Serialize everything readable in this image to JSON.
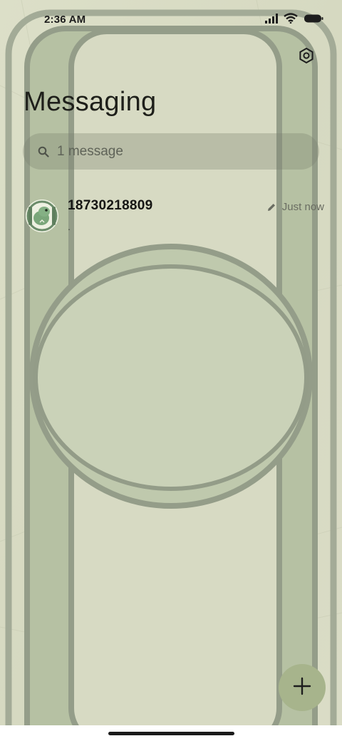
{
  "status_bar": {
    "time": "2:36 AM",
    "icons": [
      "signal-icon",
      "wifi-icon",
      "battery-icon"
    ]
  },
  "header": {
    "title": "Messaging",
    "settings_icon": "settings-icon"
  },
  "search": {
    "placeholder": "1 message",
    "icon": "search-icon"
  },
  "conversations": [
    {
      "name": "18730218809",
      "snippet": ".",
      "time": "Just now",
      "status_icon": "draft-pencil-icon",
      "avatar": "dinosaur-avatar"
    }
  ],
  "fab": {
    "icon": "plus-icon"
  },
  "colors": {
    "wallpaper": "#d9dcc4",
    "frame": "#9ca690",
    "fab": "#a7b48c"
  }
}
